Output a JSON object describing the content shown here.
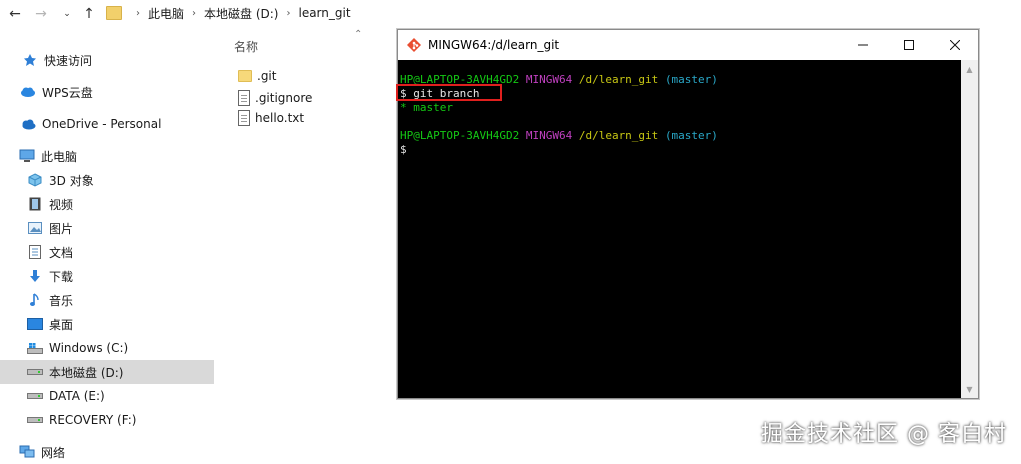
{
  "explorer": {
    "breadcrumb": [
      "此电脑",
      "本地磁盘 (D:)",
      "learn_git"
    ],
    "column_header": "名称",
    "files": [
      {
        "name": ".git",
        "icon": "folder-icon"
      },
      {
        "name": ".gitignore",
        "icon": "document-icon"
      },
      {
        "name": "hello.txt",
        "icon": "document-icon"
      }
    ]
  },
  "sidebar": {
    "items": [
      {
        "label": "快速访问",
        "icon": "pin-icon"
      },
      {
        "label": "WPS云盘",
        "icon": "cloud-icon"
      },
      {
        "label": "OneDrive - Personal",
        "icon": "onedrive-icon"
      },
      {
        "label": "此电脑",
        "icon": "computer-icon"
      },
      {
        "label": "3D 对象",
        "icon": "3d-objects-icon"
      },
      {
        "label": "视频",
        "icon": "video-icon"
      },
      {
        "label": "图片",
        "icon": "pictures-icon"
      },
      {
        "label": "文档",
        "icon": "documents-icon"
      },
      {
        "label": "下载",
        "icon": "download-icon"
      },
      {
        "label": "音乐",
        "icon": "music-icon"
      },
      {
        "label": "桌面",
        "icon": "desktop-icon"
      },
      {
        "label": "Windows (C:)",
        "icon": "drive-icon"
      },
      {
        "label": "本地磁盘 (D:)",
        "icon": "drive-icon",
        "selected": true
      },
      {
        "label": "DATA (E:)",
        "icon": "drive-icon"
      },
      {
        "label": "RECOVERY (F:)",
        "icon": "drive-icon"
      },
      {
        "label": "网络",
        "icon": "network-icon"
      }
    ]
  },
  "terminal": {
    "title": "MINGW64:/d/learn_git",
    "lines": [
      {
        "user": "HP@LAPTOP-3AVH4GD2",
        "env": "MINGW64",
        "path": "/d/learn_git",
        "branch": "(master)"
      },
      {
        "command": "$ git branch"
      },
      {
        "output": "* master"
      },
      {
        "user": "HP@LAPTOP-3AVH4GD2",
        "env": "MINGW64",
        "path": "/d/learn_git",
        "branch": "(master)"
      },
      {
        "command": "$"
      }
    ]
  },
  "watermark": "掘金技术社区 @ 客白村",
  "colors": {
    "prompt_user": "#14c814",
    "prompt_env": "#c040c0",
    "prompt_path": "#c8c814",
    "prompt_branch": "#2aa8c8",
    "highlight_box": "#e0201e",
    "selected_bg": "#d9d9d9"
  }
}
